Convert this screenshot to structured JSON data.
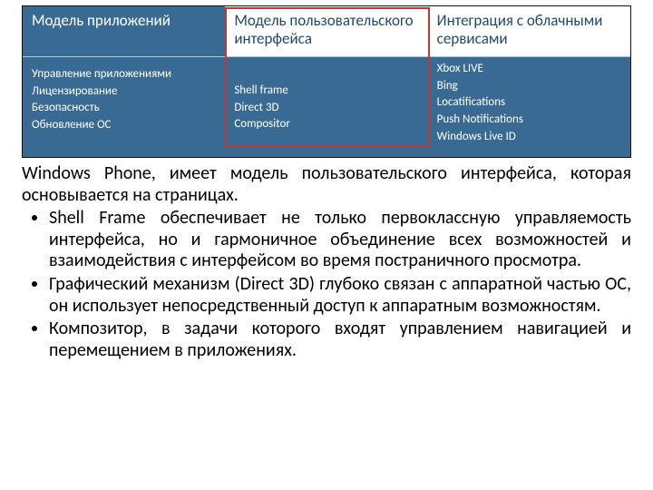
{
  "table": {
    "headers": {
      "col1": "Модель приложений",
      "col2": "Модель пользовательского интерфейса",
      "col3": "Интеграция с облачными сервисами"
    },
    "body": {
      "col1": [
        "Управление приложениями",
        "Лицензирование",
        "Безопасность",
        "Обновление ОС"
      ],
      "col2": [
        "Shell frame",
        "Direct 3D",
        "Compositor"
      ],
      "col3": [
        "Xbox LIVE",
        "Bing",
        "Locatifications",
        "Push Notifications",
        "Windows Live ID"
      ]
    }
  },
  "paragraph": "Windows Phone, имеет модель пользовательского интерфейса, которая основывается на страницах.",
  "bullets": [
    "Shell Frame обеспечивает не только первоклассную управляемость интерфейса, но и гармоничное объединение всех возможностей и взаимодействия с интерфейсом во время постраничного просмотра.",
    "Графический механизм (Direct 3D) глубоко связан с аппаратной частью ОС, он использует непосредственный доступ к аппаратным возможностям.",
    "Композитор, в задачи которого входят управлением навигацией и  перемещением в приложениях."
  ]
}
